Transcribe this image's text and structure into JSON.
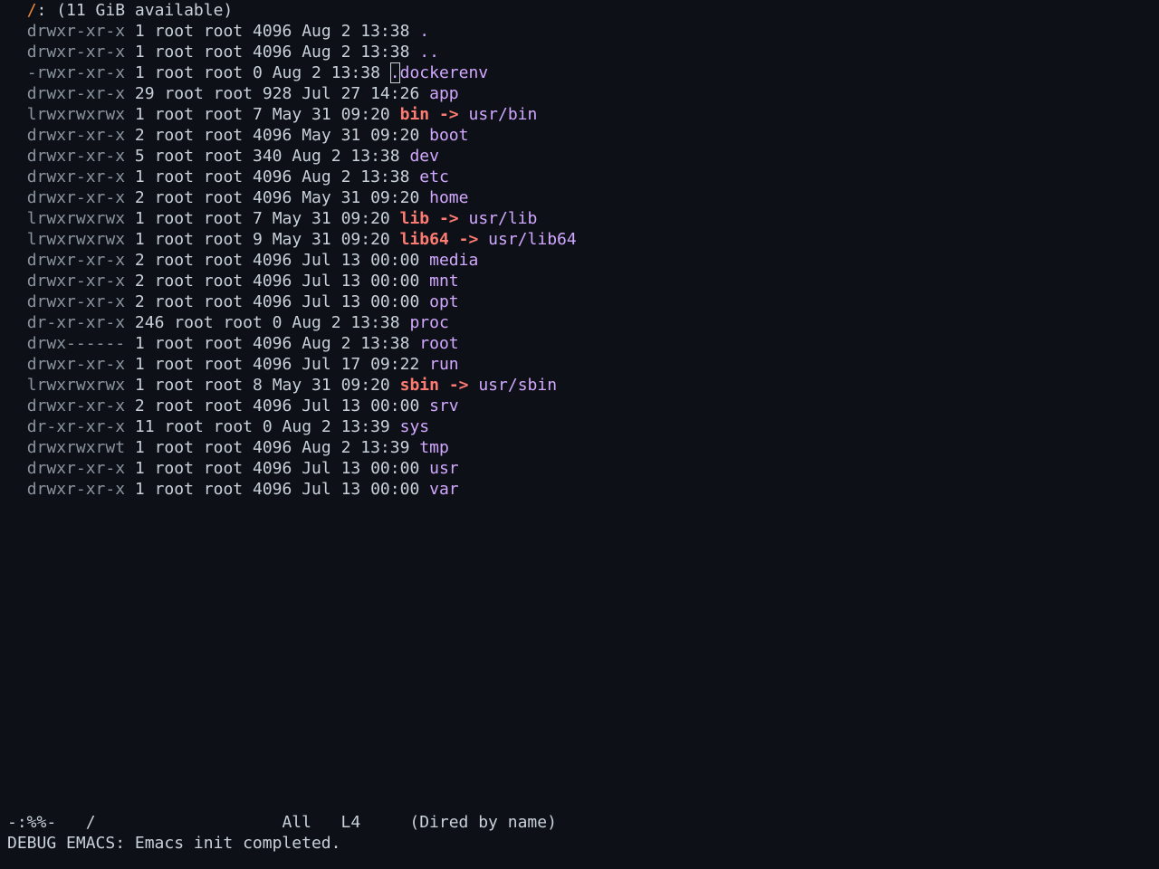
{
  "header": {
    "path": "/",
    "available": ": (11 GiB available)"
  },
  "listing": [
    {
      "perms": "drwxr-xr-x",
      "links": "1",
      "owner": "root",
      "group": "root",
      "size": "4096",
      "month": "Aug",
      "day": "2",
      "time": "13:38",
      "name": ".",
      "target": "",
      "type": "dir"
    },
    {
      "perms": "drwxr-xr-x",
      "links": "1",
      "owner": "root",
      "group": "root",
      "size": "4096",
      "month": "Aug",
      "day": "2",
      "time": "13:38",
      "name": "..",
      "target": "",
      "type": "dir"
    },
    {
      "perms": "-rwxr-xr-x",
      "links": "1",
      "owner": "root",
      "group": "root",
      "size": "0",
      "month": "Aug",
      "day": "2",
      "time": "13:38",
      "name": ".dockerenv",
      "target": "",
      "type": "file"
    },
    {
      "perms": "drwxr-xr-x",
      "links": "29",
      "owner": "root",
      "group": "root",
      "size": "928",
      "month": "Jul",
      "day": "27",
      "time": "14:26",
      "name": "app",
      "target": "",
      "type": "dir"
    },
    {
      "perms": "lrwxrwxrwx",
      "links": "1",
      "owner": "root",
      "group": "root",
      "size": "7",
      "month": "May",
      "day": "31",
      "time": "09:20",
      "name": "bin",
      "target": "usr/bin",
      "type": "link"
    },
    {
      "perms": "drwxr-xr-x",
      "links": "2",
      "owner": "root",
      "group": "root",
      "size": "4096",
      "month": "May",
      "day": "31",
      "time": "09:20",
      "name": "boot",
      "target": "",
      "type": "dir"
    },
    {
      "perms": "drwxr-xr-x",
      "links": "5",
      "owner": "root",
      "group": "root",
      "size": "340",
      "month": "Aug",
      "day": "2",
      "time": "13:38",
      "name": "dev",
      "target": "",
      "type": "dir"
    },
    {
      "perms": "drwxr-xr-x",
      "links": "1",
      "owner": "root",
      "group": "root",
      "size": "4096",
      "month": "Aug",
      "day": "2",
      "time": "13:38",
      "name": "etc",
      "target": "",
      "type": "dir"
    },
    {
      "perms": "drwxr-xr-x",
      "links": "2",
      "owner": "root",
      "group": "root",
      "size": "4096",
      "month": "May",
      "day": "31",
      "time": "09:20",
      "name": "home",
      "target": "",
      "type": "dir"
    },
    {
      "perms": "lrwxrwxrwx",
      "links": "1",
      "owner": "root",
      "group": "root",
      "size": "7",
      "month": "May",
      "day": "31",
      "time": "09:20",
      "name": "lib",
      "target": "usr/lib",
      "type": "link"
    },
    {
      "perms": "lrwxrwxrwx",
      "links": "1",
      "owner": "root",
      "group": "root",
      "size": "9",
      "month": "May",
      "day": "31",
      "time": "09:20",
      "name": "lib64",
      "target": "usr/lib64",
      "type": "link"
    },
    {
      "perms": "drwxr-xr-x",
      "links": "2",
      "owner": "root",
      "group": "root",
      "size": "4096",
      "month": "Jul",
      "day": "13",
      "time": "00:00",
      "name": "media",
      "target": "",
      "type": "dir"
    },
    {
      "perms": "drwxr-xr-x",
      "links": "2",
      "owner": "root",
      "group": "root",
      "size": "4096",
      "month": "Jul",
      "day": "13",
      "time": "00:00",
      "name": "mnt",
      "target": "",
      "type": "dir"
    },
    {
      "perms": "drwxr-xr-x",
      "links": "2",
      "owner": "root",
      "group": "root",
      "size": "4096",
      "month": "Jul",
      "day": "13",
      "time": "00:00",
      "name": "opt",
      "target": "",
      "type": "dir"
    },
    {
      "perms": "dr-xr-xr-x",
      "links": "246",
      "owner": "root",
      "group": "root",
      "size": "0",
      "month": "Aug",
      "day": "2",
      "time": "13:38",
      "name": "proc",
      "target": "",
      "type": "dir"
    },
    {
      "perms": "drwx------",
      "links": "1",
      "owner": "root",
      "group": "root",
      "size": "4096",
      "month": "Aug",
      "day": "2",
      "time": "13:38",
      "name": "root",
      "target": "",
      "type": "dir"
    },
    {
      "perms": "drwxr-xr-x",
      "links": "1",
      "owner": "root",
      "group": "root",
      "size": "4096",
      "month": "Jul",
      "day": "17",
      "time": "09:22",
      "name": "run",
      "target": "",
      "type": "dir"
    },
    {
      "perms": "lrwxrwxrwx",
      "links": "1",
      "owner": "root",
      "group": "root",
      "size": "8",
      "month": "May",
      "day": "31",
      "time": "09:20",
      "name": "sbin",
      "target": "usr/sbin",
      "type": "link"
    },
    {
      "perms": "drwxr-xr-x",
      "links": "2",
      "owner": "root",
      "group": "root",
      "size": "4096",
      "month": "Jul",
      "day": "13",
      "time": "00:00",
      "name": "srv",
      "target": "",
      "type": "dir"
    },
    {
      "perms": "dr-xr-xr-x",
      "links": "11",
      "owner": "root",
      "group": "root",
      "size": "0",
      "month": "Aug",
      "day": "2",
      "time": "13:39",
      "name": "sys",
      "target": "",
      "type": "dir"
    },
    {
      "perms": "drwxrwxrwt",
      "links": "1",
      "owner": "root",
      "group": "root",
      "size": "4096",
      "month": "Aug",
      "day": "2",
      "time": "13:39",
      "name": "tmp",
      "target": "",
      "type": "dir"
    },
    {
      "perms": "drwxr-xr-x",
      "links": "1",
      "owner": "root",
      "group": "root",
      "size": "4096",
      "month": "Jul",
      "day": "13",
      "time": "00:00",
      "name": "usr",
      "target": "",
      "type": "dir"
    },
    {
      "perms": "drwxr-xr-x",
      "links": "1",
      "owner": "root",
      "group": "root",
      "size": "4096",
      "month": "Jul",
      "day": "13",
      "time": "00:00",
      "name": "var",
      "target": "",
      "type": "dir"
    }
  ],
  "link_arrow": "->",
  "mode_line": {
    "status": "-:%%-",
    "buffer_name": "/",
    "position": "All",
    "line": "L4",
    "mode": "(Dired by name)"
  },
  "echo_area": {
    "message": "DEBUG EMACS: Emacs init completed."
  },
  "colors": {
    "background": "#0d1117",
    "foreground": "#c9d1d9",
    "directory": "#d2a8ff",
    "symlink": "#ff7b72",
    "header_path": "#f0883e"
  }
}
